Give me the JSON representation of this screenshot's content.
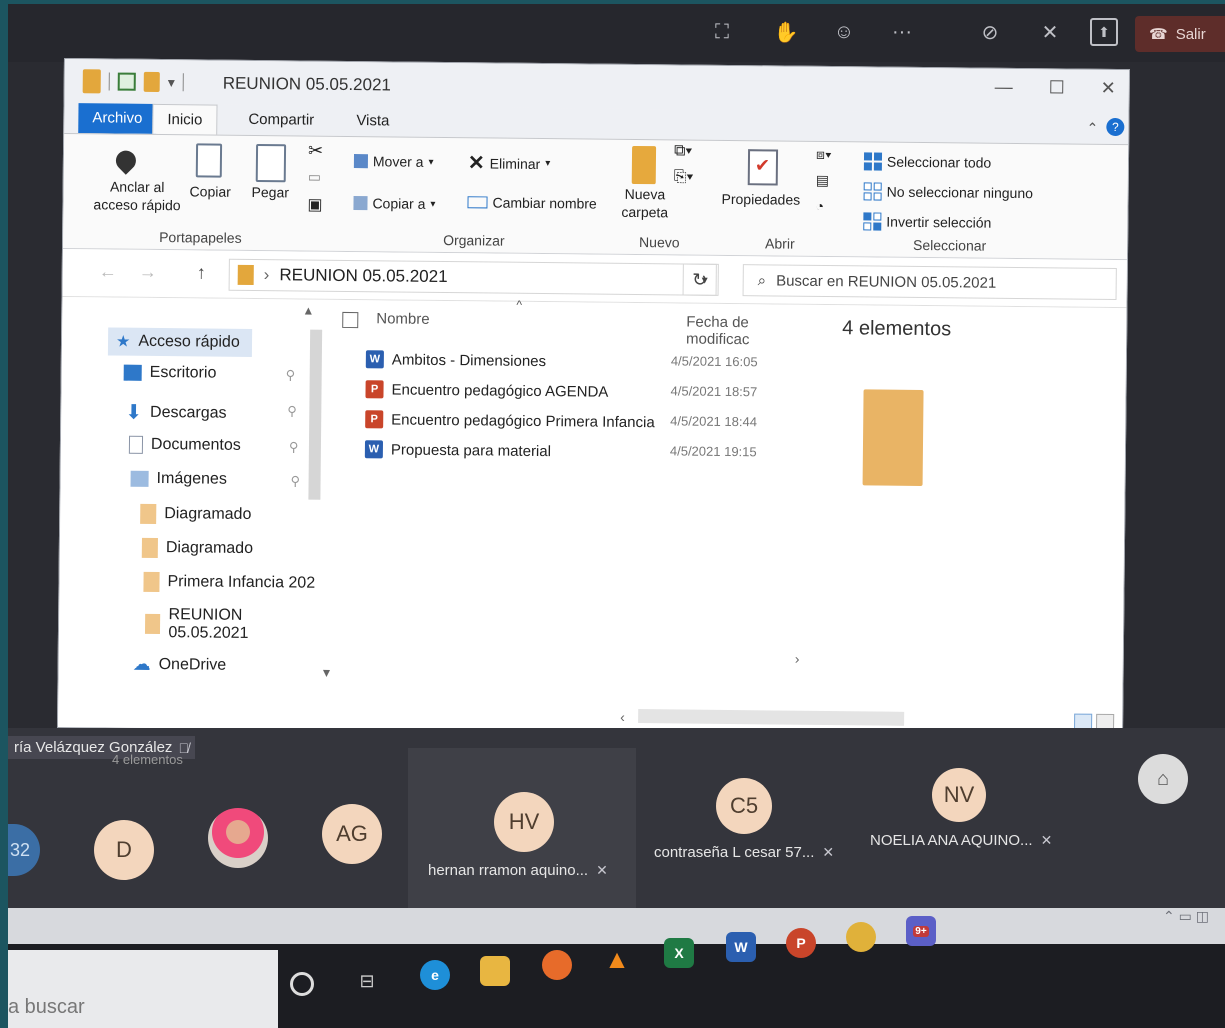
{
  "meeting_bar": {
    "leave_label": "Salir",
    "controls": [
      "participants-icon",
      "raise-hand-icon",
      "reactions-icon",
      "more-icon",
      "camera-off-icon",
      "mic-off-icon",
      "share-icon"
    ],
    "more_label": "···"
  },
  "explorer": {
    "title": "REUNION 05.05.2021",
    "tabs": [
      "Archivo",
      "Inicio",
      "Compartir",
      "Vista"
    ],
    "ribbon": {
      "portapapeles": {
        "pin_label_1": "Anclar al",
        "pin_label_2": "acceso rápido",
        "copy_label": "Copiar",
        "paste_label": "Pegar",
        "group_label": "Portapapeles"
      },
      "organizar": {
        "move_label": "Mover a",
        "copy_to_label": "Copiar a",
        "delete_label": "Eliminar",
        "rename_label": "Cambiar nombre",
        "group_label": "Organizar"
      },
      "nuevo": {
        "new_folder_label_1": "Nueva",
        "new_folder_label_2": "carpeta",
        "group_label": "Nuevo"
      },
      "abrir": {
        "properties_label": "Propiedades",
        "group_label": "Abrir"
      },
      "seleccionar": {
        "select_all": "Seleccionar todo",
        "select_none": "No seleccionar ninguno",
        "invert": "Invertir selección",
        "group_label": "Seleccionar"
      }
    },
    "address": {
      "path": "REUNION 05.05.2021",
      "separator": "›",
      "search_placeholder": "Buscar en REUNION 05.05.2021"
    },
    "nav": [
      {
        "label": "Acceso rápido"
      },
      {
        "label": "Escritorio"
      },
      {
        "label": "Descargas"
      },
      {
        "label": "Documentos"
      },
      {
        "label": "Imágenes"
      },
      {
        "label": "Diagramado"
      },
      {
        "label": "Diagramado"
      },
      {
        "label": "Primera Infancia 202"
      },
      {
        "label": "REUNION 05.05.2021"
      },
      {
        "label": "OneDrive"
      }
    ],
    "columns": {
      "name": "Nombre",
      "date": "Fecha de modificac"
    },
    "files": [
      {
        "name": "Ambitos - Dimensiones",
        "date": "4/5/2021 16:05",
        "type": "word"
      },
      {
        "name": "Encuentro pedagógico AGENDA",
        "date": "4/5/2021 18:57",
        "type": "powerpoint"
      },
      {
        "name": "Encuentro pedagógico Primera Infancia",
        "date": "4/5/2021 18:44",
        "type": "powerpoint"
      },
      {
        "name": "Propuesta para material",
        "date": "4/5/2021 19:15",
        "type": "word"
      }
    ],
    "preview_count": "4 elementos",
    "status": "4 elementos"
  },
  "gallery": {
    "presenter_name": "ría Velázquez González",
    "participants": [
      {
        "initials": "32"
      },
      {
        "initials": "D"
      },
      {
        "initials": ""
      },
      {
        "initials": "AG"
      },
      {
        "initials": "HV",
        "name": "hernan rramon aquino..."
      },
      {
        "initials": "C5",
        "name": "contraseña L cesar 57..."
      },
      {
        "initials": "NV",
        "name": "NOELIA ANA AQUINO..."
      }
    ]
  },
  "taskbar": {
    "search_text": "a buscar",
    "apps": [
      "cortana-icon",
      "task-view-icon",
      "edge-icon",
      "file-explorer-icon",
      "firefox-icon",
      "vlc-icon",
      "excel-icon",
      "word-icon",
      "powerpoint-icon",
      "chrome-icon",
      "teams-icon"
    ],
    "teams_badge": "9+"
  },
  "colors": {
    "accent": "#1a6fd0",
    "folder": "#e3a73c",
    "meeting_bg": "#34353c",
    "leave": "#5e2d2a"
  }
}
